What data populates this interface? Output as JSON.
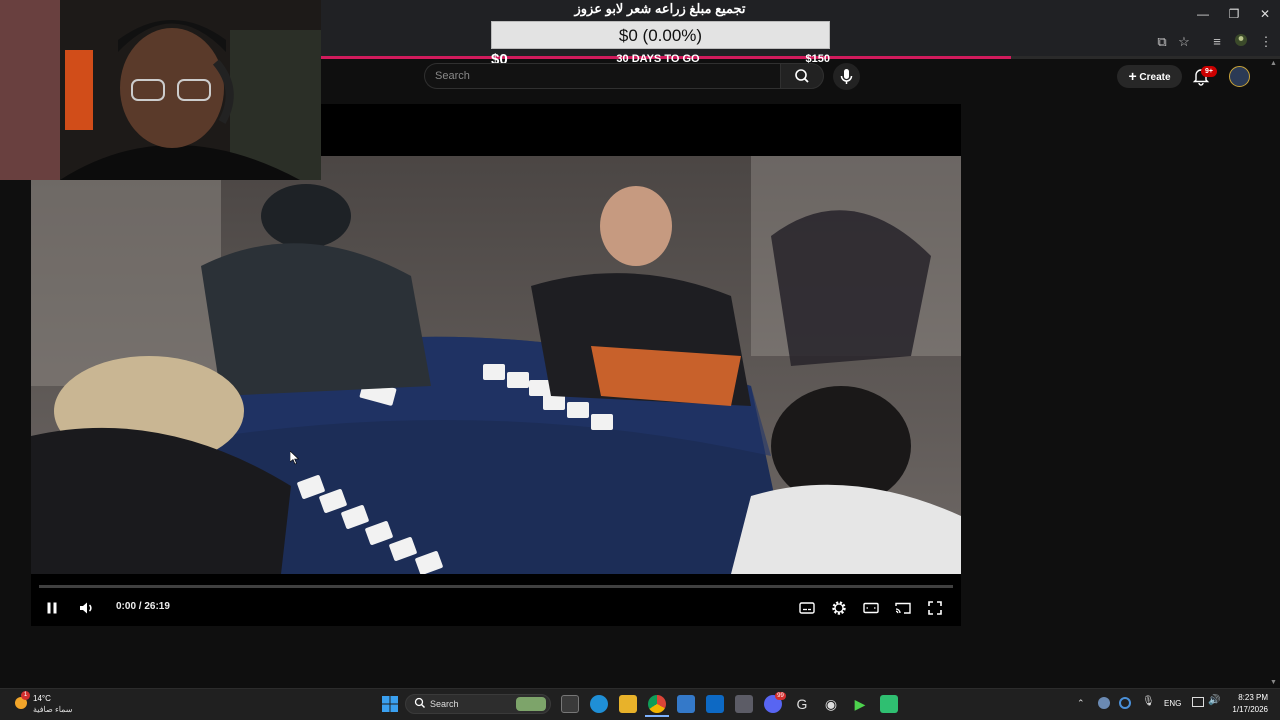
{
  "overlay": {
    "title": "تجميع مبلغ زراعه شعر لابو عزوز",
    "amount": "$0 (0.00%)",
    "min": "$0",
    "days": "30 DAYS TO GO",
    "max": "$150"
  },
  "header": {
    "search_placeholder": "Search",
    "create_label": "Create",
    "notif_count": "9+"
  },
  "player": {
    "time": "0:00 / 26:19",
    "progress_fraction": 0.0
  },
  "chrome": {
    "loading_fraction": 0.72
  },
  "taskbar": {
    "weather_temp": "14°C",
    "weather_desc": "سماء صافية",
    "weather_badge": "1",
    "search_label": "Search",
    "discord_badge": "99",
    "lang": "ENG",
    "time": "8:23 PM",
    "date": "1/17/2026"
  },
  "colors": {
    "accent": "#d11b5c",
    "youtube_red": "#ff0000",
    "taskbar": "#202020"
  }
}
